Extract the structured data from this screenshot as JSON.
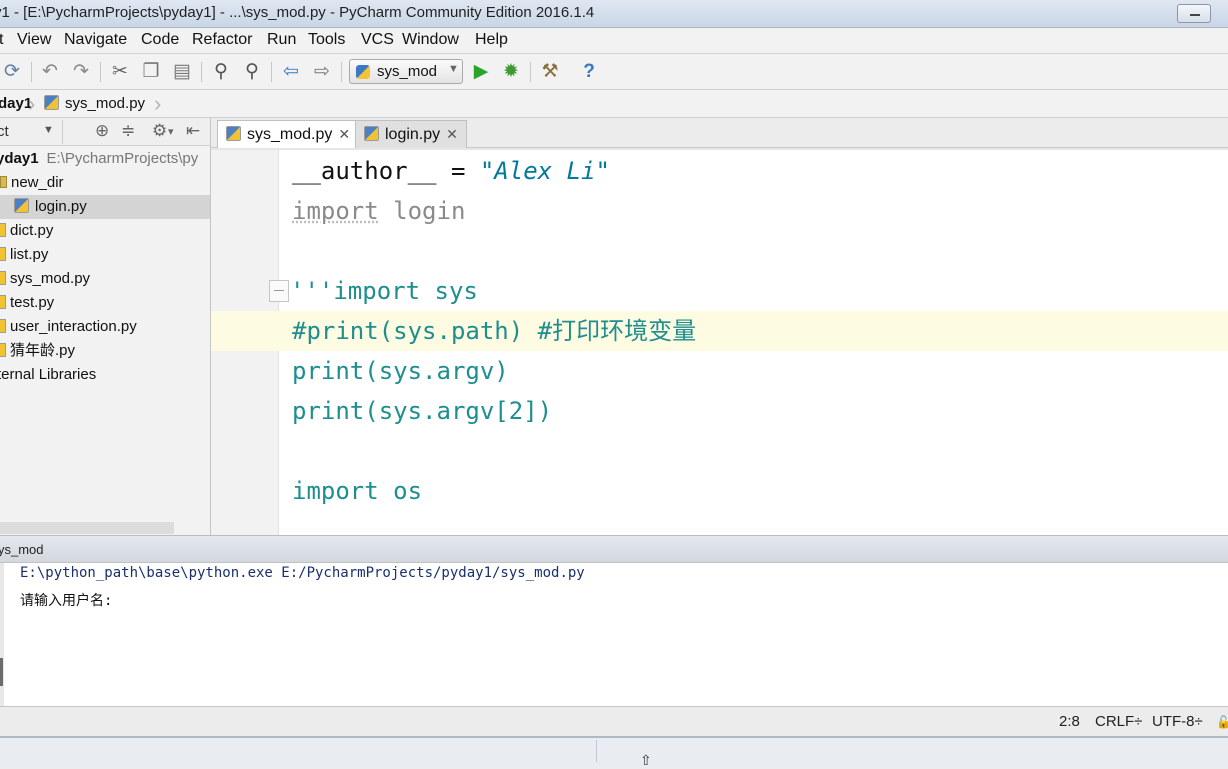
{
  "window": {
    "title": "y1 - [E:\\PycharmProjects\\pyday1] - ...\\sys_mod.py - PyCharm Community Edition 2016.1.4"
  },
  "menu": {
    "items": [
      {
        "label": "t"
      },
      {
        "label": "View"
      },
      {
        "label": "Navigate"
      },
      {
        "label": "Code"
      },
      {
        "label": "Refactor"
      },
      {
        "label": "Run"
      },
      {
        "label": "Tools"
      },
      {
        "label": "VCS"
      },
      {
        "label": "Window"
      },
      {
        "label": "Help"
      }
    ]
  },
  "toolbar": {
    "run_config": "sys_mod",
    "icons": [
      "sync-icon",
      "undo-icon",
      "redo-icon",
      "cut-icon",
      "copy-icon",
      "paste-icon",
      "find-icon",
      "replace-icon",
      "back-icon",
      "forward-icon",
      "run-icon",
      "debug-icon",
      "settings-icon",
      "help-icon"
    ]
  },
  "breadcrumb": {
    "project": "day1",
    "file": "sys_mod.py"
  },
  "project_panel": {
    "view_label": "ct",
    "tree": [
      {
        "label": "yday1",
        "path": "E:\\PycharmProjects\\py"
      },
      {
        "label": "new_dir"
      },
      {
        "label": "login.py"
      },
      {
        "label": "dict.py"
      },
      {
        "label": "list.py"
      },
      {
        "label": "sys_mod.py"
      },
      {
        "label": "test.py"
      },
      {
        "label": "user_interaction.py"
      },
      {
        "label": "猜年龄.py"
      },
      {
        "label": "ternal Libraries"
      }
    ]
  },
  "editor": {
    "tabs": [
      {
        "label": "sys_mod.py",
        "active": true
      },
      {
        "label": "login.py",
        "active": false
      }
    ],
    "lines": {
      "l1_a": "__author__",
      "l1_b": " = ",
      "l1_c": "\"Alex Li\"",
      "l2_a": "import",
      "l2_b": " login",
      "l4": "'''import sys",
      "l5": "#print(sys.path) #打印环境变量",
      "l6": "print(sys.argv)",
      "l7": "print(sys.argv[2])",
      "l9": "import os"
    }
  },
  "run_panel": {
    "title": "ys_mod",
    "command": "E:\\python_path\\base\\python.exe E:/PycharmProjects/pyday1/sys_mod.py",
    "output": "请输入用户名:"
  },
  "status": {
    "position": "2:8",
    "line_sep": "CRLF÷",
    "encoding": "UTF-8÷"
  }
}
